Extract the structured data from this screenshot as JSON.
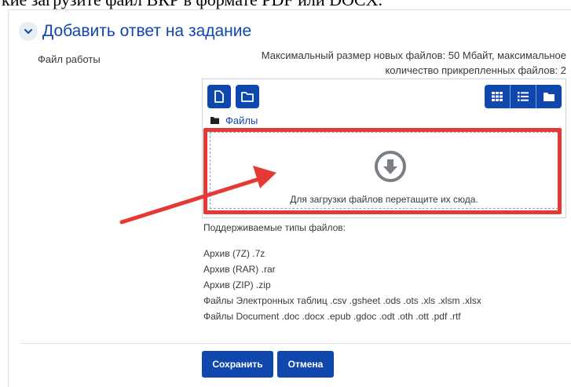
{
  "top_text": "кие загрузите файл ВКР в формате PDF или DOCX.",
  "section": {
    "title": "Добавить ответ на задание"
  },
  "field": {
    "label": "Файл работы"
  },
  "limits": {
    "line1": "Максимальный размер новых файлов: 50 Мбайт, максимальное",
    "line2": "количество прикрепленных файлов: 2"
  },
  "filemanager": {
    "breadcrumb": "Файлы",
    "drop_hint": "Для загрузки файлов перетащите их сюда."
  },
  "types": {
    "header": "Поддерживаемые типы файлов:",
    "items": [
      "Архив (7Z) .7z",
      "Архив (RAR) .rar",
      "Архив (ZIP) .zip",
      "Файлы Электронных таблиц .csv .gsheet .ods .ots .xls .xlsm .xlsx",
      "Файлы Document .doc .docx .epub .gdoc .odt .oth .ott .pdf .rtf"
    ]
  },
  "buttons": {
    "save": "Сохранить",
    "cancel": "Отмена"
  },
  "colors": {
    "primary": "#0f47ad",
    "highlight": "#e53935"
  }
}
